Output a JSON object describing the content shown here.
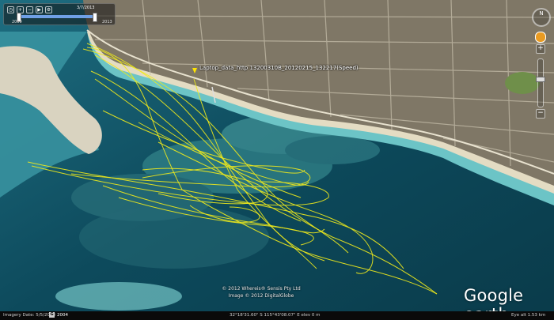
{
  "timeline": {
    "start_label": "12/1/2009",
    "end_label": "3/7/2013",
    "left_end": "2009",
    "right_end": "2013",
    "icons": [
      "history-icon",
      "zoom-in-time-icon",
      "zoom-out-time-icon",
      "play-icon",
      "settings-icon"
    ]
  },
  "placemark": {
    "label": "Laptop_data_http 13200310B_20120215_132217(Speed)",
    "pin_color": "#ffe400"
  },
  "copyright": {
    "line1": "© 2012 Whereis® Sensis Pty Ltd",
    "line2": "Image © 2012 DigitalGlobe"
  },
  "logo": "Google earth",
  "status_bar": {
    "imagery_date": "Imagery Date: 5/5/2008",
    "year": "2004",
    "coords": "32°18'31.60\" S  115°43'08.07\" E  elev   0 m",
    "eye_alt": "Eye alt   1.53 km"
  },
  "navigation": {
    "compass_label": "N",
    "zoom_in": "+",
    "zoom_out": "−"
  },
  "colors": {
    "track": "#f0ea1c",
    "deep_water": "#0d4a5c",
    "reef": "#2f7f86",
    "shallow": "#7fd3d2",
    "sand": "#d6d0bc"
  }
}
